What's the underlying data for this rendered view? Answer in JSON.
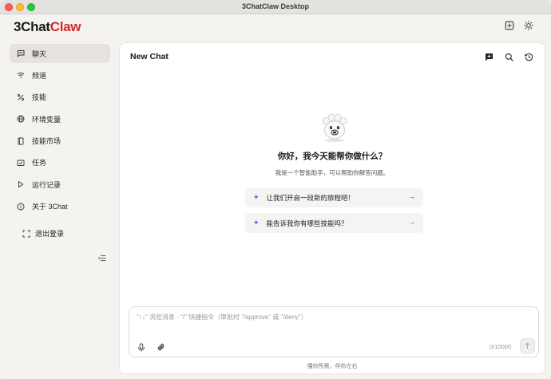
{
  "window": {
    "title": "3ChatClaw Desktop"
  },
  "brand": {
    "part1": "3Chat",
    "part2": "Claw",
    "accent_color": "#d22a2a"
  },
  "top_icons": [
    "layout-icon",
    "sun-icon"
  ],
  "sidebar": {
    "items": [
      {
        "label": "聊天",
        "icon": "chat-icon",
        "active": true
      },
      {
        "label": "频道",
        "icon": "wifi-icon"
      },
      {
        "label": "技能",
        "icon": "percent-icon"
      },
      {
        "label": "环境变量",
        "icon": "globe-icon"
      },
      {
        "label": "技能市场",
        "icon": "book-icon"
      },
      {
        "label": "任务",
        "icon": "task-icon"
      },
      {
        "label": "运行记录",
        "icon": "play-icon"
      },
      {
        "label": "关于 3Chat",
        "icon": "info-icon"
      }
    ],
    "logout_label": "退出登录"
  },
  "main": {
    "title": "New Chat",
    "greeting": "你好，我今天能帮你做什么？",
    "subtext": "我是一个智能助手，可以帮助你解答问题。",
    "suggestions": [
      {
        "label": "让我们开启一段新的旅程吧！"
      },
      {
        "label": "能告诉我你有哪些技能吗？"
      }
    ],
    "input": {
      "placeholder": "\"↑↓\" 浏览消息 · \"/\" 快捷指令（审批时 \"/approve\" 或 \"/deny\"）",
      "value": "",
      "counter": "0/10000"
    },
    "footer": "懂你所需，伴你左右"
  },
  "colors": {
    "accent": "#5b57e8",
    "panel_bg": "#ffffff",
    "sidebar_bg": "#f5f3ef"
  }
}
